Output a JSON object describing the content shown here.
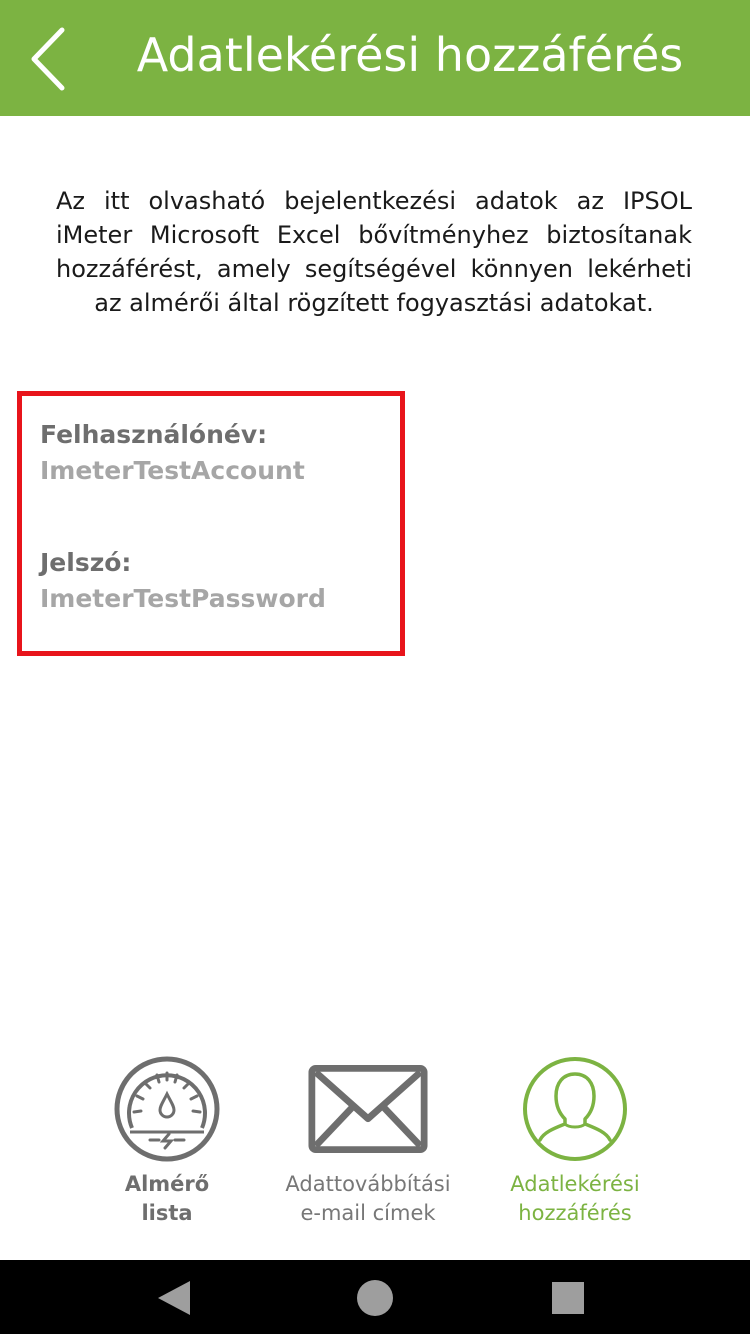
{
  "header": {
    "title": "Adatlekérési hozzáférés",
    "background_color": "#7cb342",
    "back_icon": "chevron-left-icon"
  },
  "main": {
    "description": "Az itt olvasható bejelentkezési adatok az IPSOL iMeter Microsoft Excel bővítményhez biztosítanak hozzáférést, amely segítségével könnyen lekérheti az almérői által rögzített fogyasztási adatokat.",
    "credentials": {
      "border_color": "#e8141b",
      "username_label": "Felhasználónév:",
      "username_value": "ImeterTestAccount",
      "password_label": "Jelszó:",
      "password_value": "ImeterTestPassword"
    }
  },
  "bottom_nav": {
    "items": [
      {
        "icon": "gauge-meter-icon",
        "label_line1": "Almérő",
        "label_line2": "lista",
        "active": false
      },
      {
        "icon": "envelope-icon",
        "label_line1": "Adattovábbítási",
        "label_line2": "e-mail címek",
        "active": false
      },
      {
        "icon": "user-profile-icon",
        "label_line1": "Adatlekérési",
        "label_line2": "hozzáférés",
        "active": true
      }
    ],
    "active_color": "#7cb342",
    "inactive_color": "#6e6e6e"
  },
  "system_nav": {
    "icons": [
      "back-triangle-icon",
      "home-circle-icon",
      "recents-square-icon"
    ]
  }
}
